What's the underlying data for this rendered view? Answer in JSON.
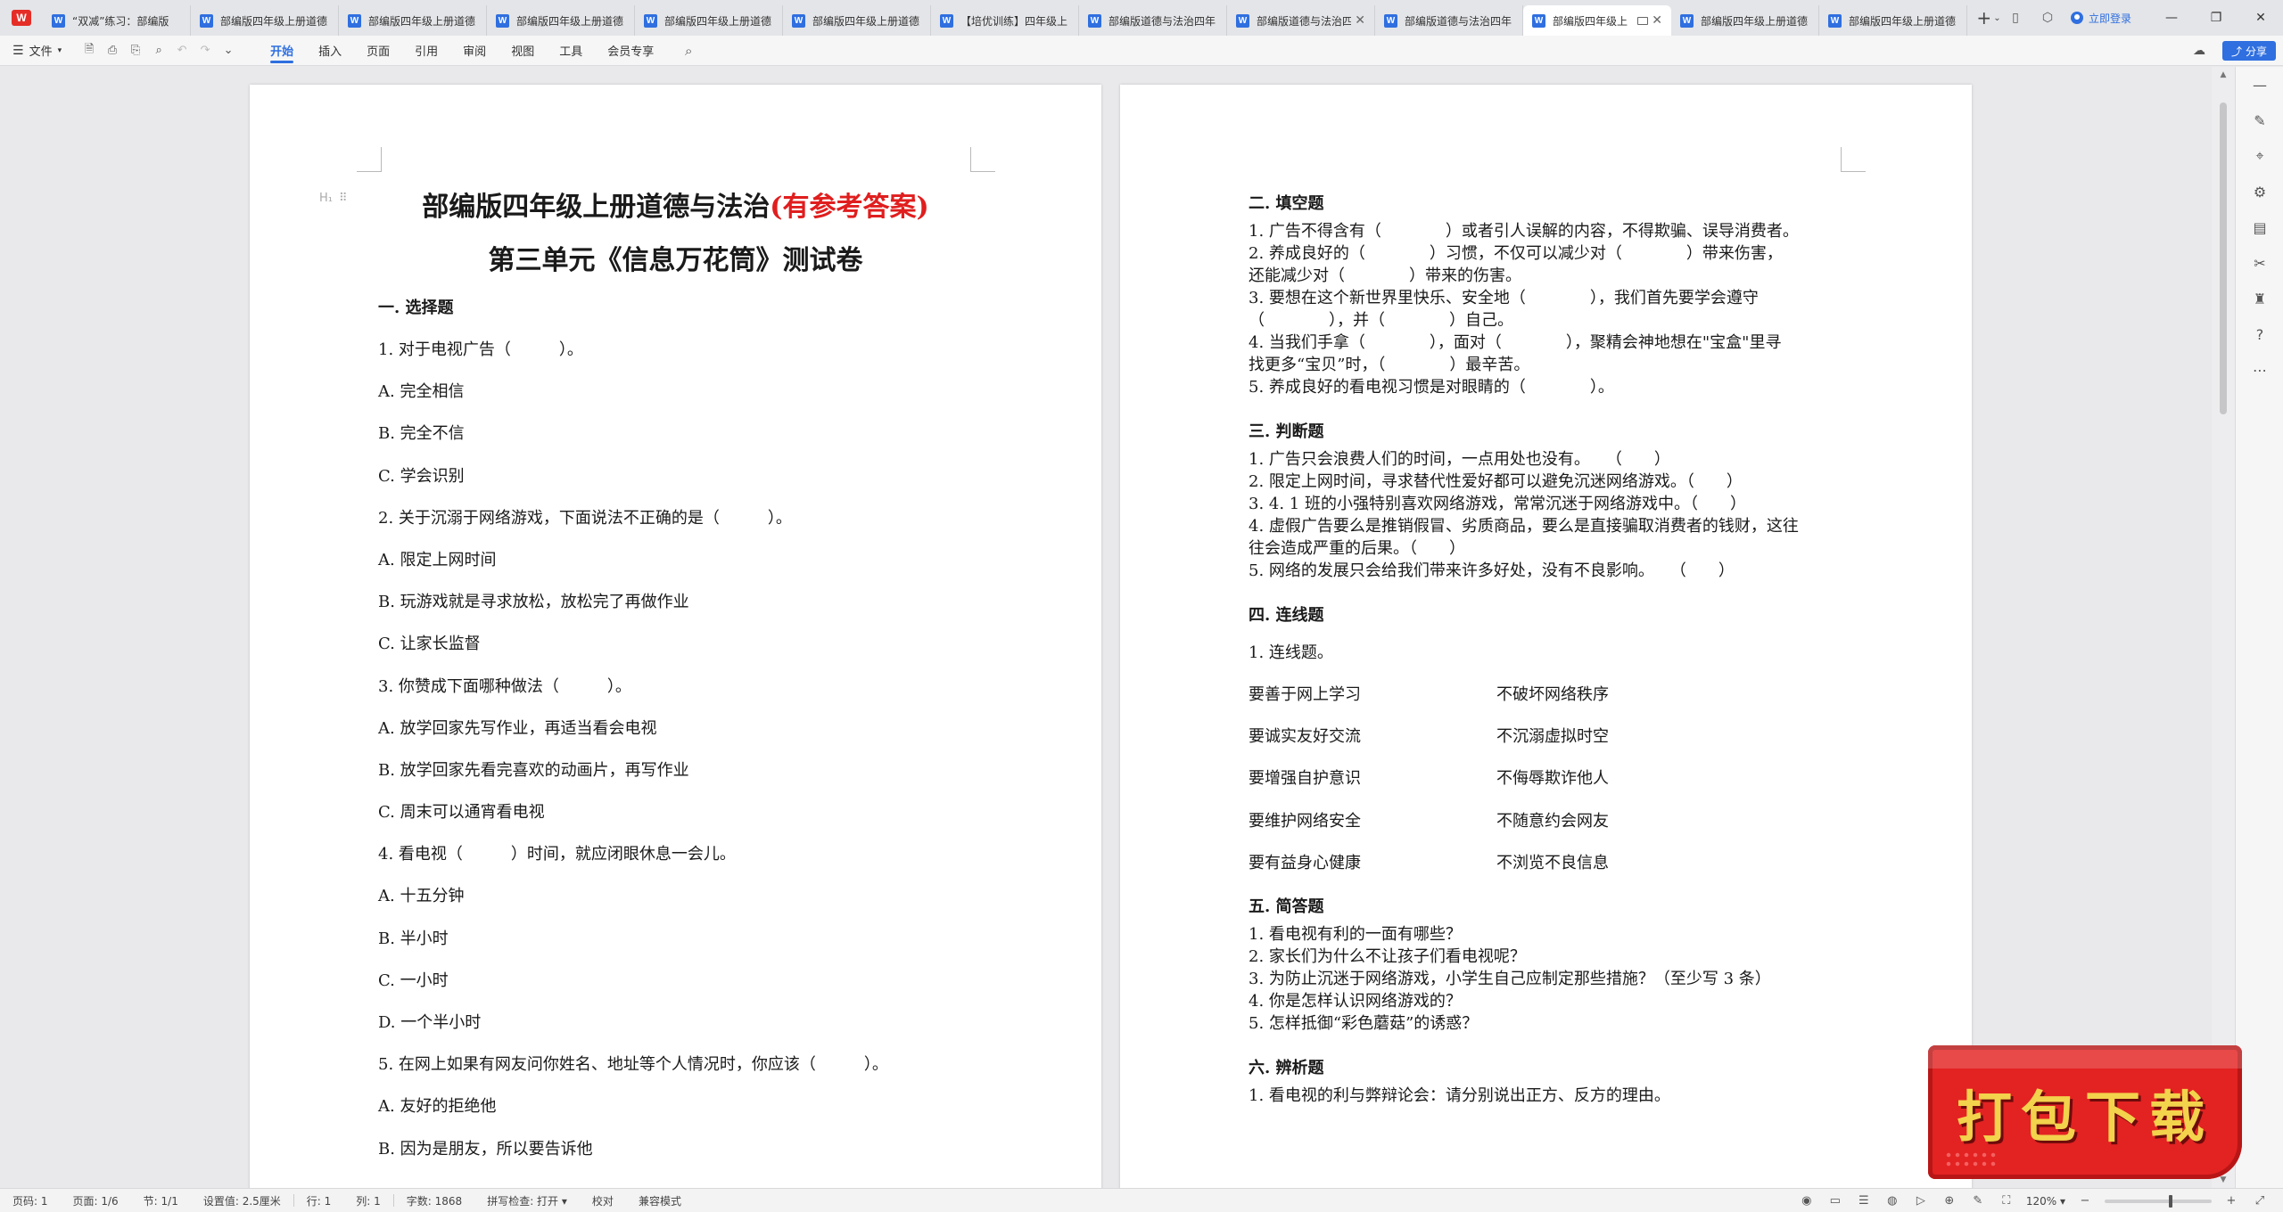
{
  "tabbar": {
    "tabs": [
      {
        "label": "“双减”练习：部编版",
        "active": false
      },
      {
        "label": "部编版四年级上册道德",
        "active": false
      },
      {
        "label": "部编版四年级上册道德",
        "active": false
      },
      {
        "label": "部编版四年级上册道德",
        "active": false
      },
      {
        "label": "部编版四年级上册道德",
        "active": false
      },
      {
        "label": "部编版四年级上册道德",
        "active": false
      },
      {
        "label": "【培优训练】四年级上",
        "active": false
      },
      {
        "label": "部编版道德与法治四年",
        "active": false
      },
      {
        "label": "部编版道德与法治四年",
        "active": false
      },
      {
        "label": "部编版道德与法治四年",
        "active": false
      },
      {
        "label": "部编版四年级上",
        "active": true
      },
      {
        "label": "部编版四年级上册道德",
        "active": false
      },
      {
        "label": "部编版四年级上册道德",
        "active": false
      }
    ],
    "login_label": "立即登录"
  },
  "menubar": {
    "file_label": "文件",
    "ribbon_tabs": [
      "开始",
      "插入",
      "页面",
      "引用",
      "审阅",
      "视图",
      "工具",
      "会员专享"
    ],
    "active_tab": "开始",
    "share_label": "分享"
  },
  "page1": {
    "title_main": "部编版四年级上册道德与法治",
    "title_highlight": "(有参考答案)",
    "subtitle": "第三单元《信息万花筒》测试卷",
    "heading_marker": "H₁",
    "section1": "一. 选择题",
    "lines": [
      "1. 对于电视广告（　　　）。",
      "A. 完全相信",
      "B. 完全不信",
      "C. 学会识别",
      "2. 关于沉溺于网络游戏，下面说法不正确的是（　　　）。",
      "A. 限定上网时间",
      "B. 玩游戏就是寻求放松，放松完了再做作业",
      "C. 让家长监督",
      "3. 你赞成下面哪种做法（　　　）。",
      "A. 放学回家先写作业，再适当看会电视",
      "B. 放学回家先看完喜欢的动画片，再写作业",
      "C. 周末可以通宵看电视",
      "4. 看电视（　　　）时间，就应闭眼休息一会儿。",
      "A. 十五分钟",
      "B. 半小时",
      "C. 一小时",
      "D. 一个半小时",
      "5. 在网上如果有网友问你姓名、地址等个人情况时，你应该（　　　）。",
      "A. 友好的拒绝他",
      "B. 因为是朋友，所以要告诉他"
    ]
  },
  "page2": {
    "section2": "二. 填空题",
    "fill_lines": [
      "1. 广告不得含有（　　　　）或者引人误解的内容，不得欺骗、误导消费者。",
      "2. 养成良好的（　　　　）习惯，不仅可以减少对（　　　　）带来伤害，",
      "还能减少对（　　　　）带来的伤害。",
      "3. 要想在这个新世界里快乐、安全地（　　　　），我们首先要学会遵守",
      "（　　　　），并（　　　　）自己。",
      "4. 当我们手拿（　　　　），面对（　　　　），聚精会神地想在\"宝盒\"里寻",
      "找更多“宝贝”时，（　　　　）最辛苦。",
      "5. 养成良好的看电视习惯是对眼睛的（　　　　）。"
    ],
    "section3": "三. 判断题",
    "judge_lines": [
      "1. 广告只会浪费人们的时间，一点用处也没有。　　（　　）",
      "2. 限定上网时间，寻求替代性爱好都可以避免沉迷网络游戏。（　　）",
      "3. 4. 1 班的小强特别喜欢网络游戏，常常沉迷于网络游戏中。（　　）",
      "4. 虚假广告要么是推销假冒、劣质商品，要么是直接骗取消费者的钱财，这往",
      "往会造成严重的后果。（　　）",
      "5. 网络的发展只会给我们带来许多好处，没有不良影响。　　（　　）"
    ],
    "section4": "四. 连线题",
    "match_intro": "1. 连线题。",
    "match_rows": [
      {
        "left": "要善于网上学习",
        "right": "不破坏网络秩序"
      },
      {
        "left": "要诚实友好交流",
        "right": "不沉溺虚拟时空"
      },
      {
        "left": "要增强自护意识",
        "right": "不侮辱欺诈他人"
      },
      {
        "left": "要维护网络安全",
        "right": "不随意约会网友"
      },
      {
        "left": "要有益身心健康",
        "right": "不浏览不良信息"
      }
    ],
    "section5": "五. 简答题",
    "short_lines": [
      "1. 看电视有利的一面有哪些？",
      "2. 家长们为什么不让孩子们看电视呢？",
      "3. 为防止沉迷于网络游戏，小学生自己应制定那些措施？（至少写 3 条）",
      "4. 你是怎样认识网络游戏的？",
      "5. 怎样抵御“彩色蘑菇”的诱惑？"
    ],
    "section6": "六. 辨析题",
    "analysis_lines": [
      "1. 看电视的利与弊辩论会：请分别说出正方、反方的理由。"
    ]
  },
  "statusbar": {
    "page_num": "页码: 1",
    "pages": "页面: 1/6",
    "section": "节: 1/1",
    "setting": "设置值: 2.5厘米",
    "row": "行: 1",
    "col": "列: 1",
    "word_count": "字数: 1868",
    "spellcheck": "拼写检查: 打开",
    "proof": "校对",
    "compat": "兼容模式",
    "zoom": "120%"
  },
  "banner": {
    "text": "打包下载"
  },
  "colors": {
    "accent": "#2f6fe0",
    "title_red": "#e01e1e",
    "banner_red": "#e32222",
    "banner_gold": "#f3d24c"
  }
}
